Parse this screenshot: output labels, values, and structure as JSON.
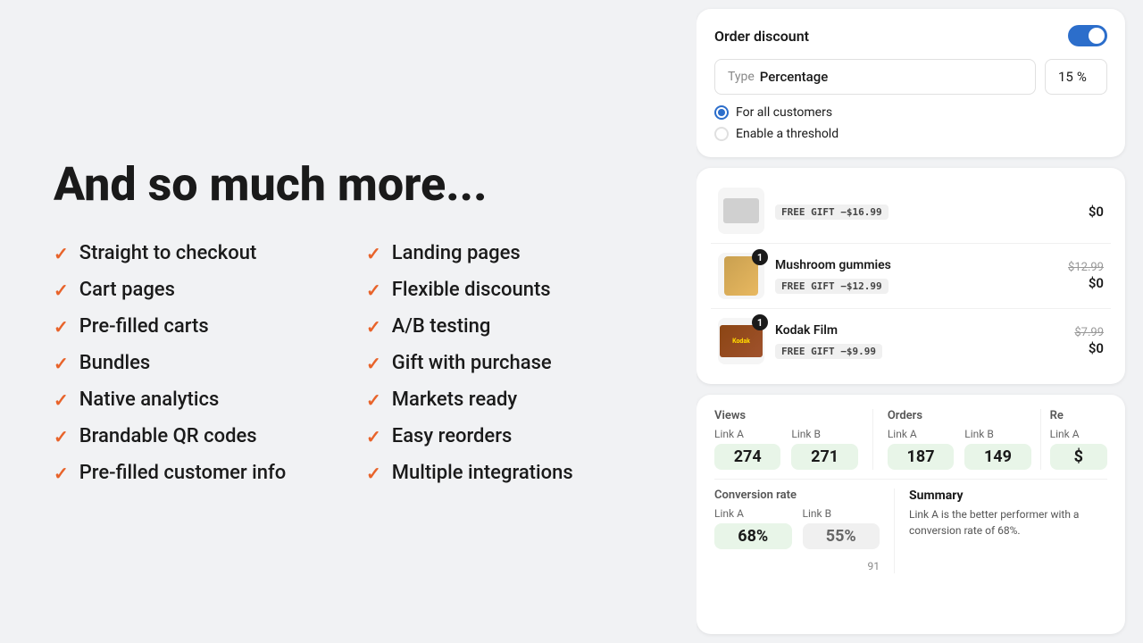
{
  "heading": "And so much more...",
  "features": {
    "left": [
      "Straight to checkout",
      "Cart pages",
      "Pre-filled carts",
      "Bundles",
      "Native analytics",
      "Brandable QR codes",
      "Pre-filled customer info"
    ],
    "right": [
      "Landing pages",
      "Flexible discounts",
      "A/B testing",
      "Gift with purchase",
      "Markets ready",
      "Easy reorders",
      "Multiple integrations"
    ]
  },
  "order_discount_card": {
    "title": "Order discount",
    "type_label": "Type",
    "type_value": "Percentage",
    "percent_value": "15",
    "percent_symbol": "%",
    "radio_options": [
      {
        "label": "For all customers",
        "selected": true
      },
      {
        "label": "Enable a threshold",
        "selected": false
      }
    ]
  },
  "gift_items_card": {
    "items": [
      {
        "name": null,
        "gift_tag": "FREE GIFT −$16.99",
        "price_original": null,
        "price_final": "$0",
        "has_badge": false,
        "thumb_type": "gray"
      },
      {
        "name": "Mushroom gummies",
        "gift_tag": "FREE GIFT −$12.99",
        "price_original": "$12.99",
        "price_final": "$0",
        "has_badge": true,
        "badge_num": "1",
        "thumb_type": "gummy"
      },
      {
        "name": "Kodak Film",
        "gift_tag": "FREE GIFT −$9.99",
        "price_original": "$7.99",
        "price_final": "$0",
        "has_badge": true,
        "badge_num": "1",
        "thumb_type": "kodak"
      }
    ]
  },
  "analytics_card": {
    "views_label": "Views",
    "orders_label": "Orders",
    "revenue_label": "Re",
    "link_a_label": "Link A",
    "link_b_label": "Link B",
    "views_a": "274",
    "views_b": "271",
    "orders_a": "187",
    "orders_b": "149",
    "revenue_partial": "$",
    "conversion_label": "Conversion rate",
    "conv_a": "68%",
    "conv_b": "55%",
    "summary_title": "Summary",
    "summary_text": "Link A is the better performer with a conversion rate of 68%.",
    "page_num": "91"
  }
}
